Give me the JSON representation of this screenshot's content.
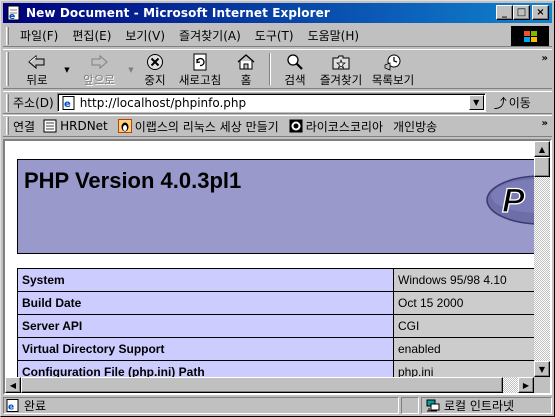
{
  "window": {
    "title": "New Document - Microsoft Internet Explorer",
    "controls": {
      "minimize": "_",
      "maximize": "□",
      "close": "×"
    }
  },
  "menu": [
    "파일(F)",
    "편집(E)",
    "보기(V)",
    "즐겨찾기(A)",
    "도구(T)",
    "도움말(H)"
  ],
  "toolbar": {
    "back": "뒤로",
    "forward": "앞으로",
    "stop": "중지",
    "refresh": "새로고침",
    "home": "홈",
    "search": "검색",
    "favorites": "즐겨찾기",
    "history": "목록보기",
    "more": "»"
  },
  "address": {
    "label": "주소(D)",
    "url": "http://localhost/phpinfo.php",
    "go": "이동"
  },
  "links": {
    "label": "연결",
    "items": [
      "HRDNet",
      "이랩스의 리눅스 세상 만들기",
      "라이코스코리아",
      "개인방송"
    ],
    "more": "»"
  },
  "page": {
    "title": "PHP Version 4.0.3pl1",
    "logo_text": "P",
    "rows": [
      {
        "label": "System",
        "value": "Windows 95/98 4.10"
      },
      {
        "label": "Build Date",
        "value": "Oct 15 2000"
      },
      {
        "label": "Server API",
        "value": "CGI"
      },
      {
        "label": "Virtual Directory Support",
        "value": "enabled"
      },
      {
        "label": "Configuration File (php.ini) Path",
        "value": "php.ini"
      }
    ]
  },
  "status": {
    "text": "완료",
    "zone": "로컬 인트라넷"
  },
  "colors": {
    "titlebar_start": "#00007b",
    "titlebar_end": "#1084d0",
    "php_header": "#9999cc",
    "php_label_cell": "#ccccff",
    "php_value_cell": "#cccccc"
  }
}
